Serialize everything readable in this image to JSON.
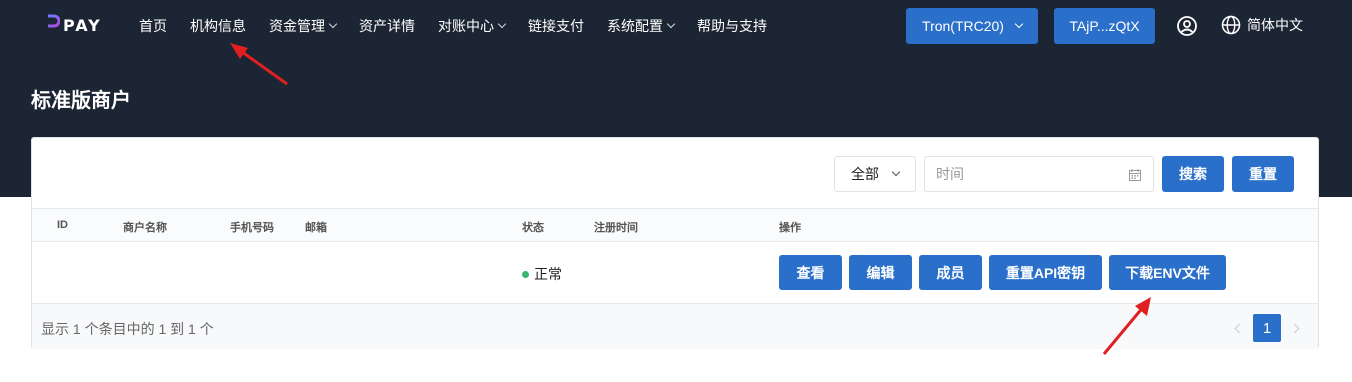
{
  "brand": {
    "name": "PAY"
  },
  "nav": {
    "items": [
      {
        "label": "首页",
        "dropdown": false
      },
      {
        "label": "机构信息",
        "dropdown": false
      },
      {
        "label": "资金管理",
        "dropdown": true
      },
      {
        "label": "资产详情",
        "dropdown": false
      },
      {
        "label": "对账中心",
        "dropdown": true
      },
      {
        "label": "链接支付",
        "dropdown": false
      },
      {
        "label": "系统配置",
        "dropdown": true
      },
      {
        "label": "帮助与支持",
        "dropdown": false
      }
    ],
    "network_label": "Tron(TRC20)",
    "address_label": "TAjP...zQtX",
    "user_icon": "user-circle-icon",
    "language": "简体中文",
    "language_icon": "globe-icon"
  },
  "page": {
    "title": "标准版商户"
  },
  "filters": {
    "status_select": "全部",
    "date_placeholder": "时间",
    "search_label": "搜索",
    "reset_label": "重置"
  },
  "table": {
    "headers": [
      "ID",
      "商户名称",
      "手机号码",
      "邮箱",
      "状态",
      "注册时间",
      "操作"
    ],
    "rows": [
      {
        "id": "",
        "name": "",
        "phone": "",
        "email": "",
        "status": "正常",
        "registered": ""
      }
    ],
    "actions": [
      "查看",
      "编辑",
      "成员",
      "重置API密钥",
      "下载ENV文件"
    ]
  },
  "footer": {
    "summary": "显示 1 个条目中的 1 到 1 个",
    "current_page": "1"
  },
  "colors": {
    "header_bg": "#1c2534",
    "primary": "#2a6fc9",
    "status_ok": "#3cb371",
    "annotation_arrow": "#e02020"
  }
}
